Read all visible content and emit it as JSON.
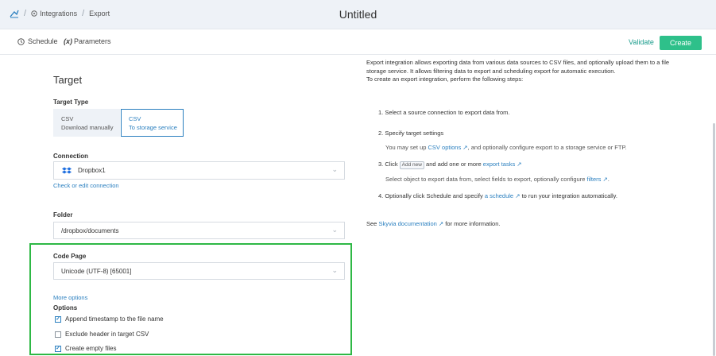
{
  "header": {
    "breadcrumb": [
      "Integrations",
      "Export"
    ],
    "title": "Untitled"
  },
  "subbar": {
    "tabs": [
      "Schedule",
      "Parameters"
    ],
    "parameters_prefix": "(x)",
    "validate_label": "Validate",
    "create_label": "Create"
  },
  "target": {
    "title": "Target",
    "type_label": "Target Type",
    "types": [
      {
        "name": "CSV",
        "desc": "Download manually",
        "selected": false
      },
      {
        "name": "CSV",
        "desc": "To storage service",
        "selected": true
      }
    ],
    "connection_label": "Connection",
    "connection_value": "Dropbox1",
    "check_link": "Check or edit connection",
    "folder_label": "Folder",
    "folder_value": "/dropbox/documents",
    "code_page_label": "Code Page",
    "code_page_value": "Unicode (UTF-8) [65001]",
    "more_options": "More options",
    "options_label": "Options",
    "options": [
      {
        "label": "Append timestamp to the file name",
        "checked": true
      },
      {
        "label": "Exclude header in target CSV",
        "checked": false
      },
      {
        "label": "Create empty files",
        "checked": true
      }
    ]
  },
  "help": {
    "intro": "Export integration allows exporting data from various data sources to CSV files, and optionally upload them to a file storage service. It allows filtering data to export and scheduling export for automatic execution.",
    "intro2": "To create an export integration, perform the following steps:",
    "step1": "1. Select a source connection to export data from.",
    "step2": "2. Specify target settings",
    "step2_sub_a": "You may set up ",
    "step2_sub_link": "CSV options",
    "step2_sub_b": ", and optionally configure export to a storage service or FTP.",
    "step3_a": "3. Click ",
    "step3_kbd": "Add new",
    "step3_b": " and add one or more ",
    "step3_link": "export tasks",
    "step3_sub_a": "Select object to export data from, select fields to export, optionally configure ",
    "step3_sub_link": "filters",
    "step3_sub_b": ".",
    "step4_a": "4. Optionally click Schedule and specify ",
    "step4_link": "a schedule",
    "step4_b": " to run your integration automatically.",
    "see_a": "See ",
    "see_link": "Skyvia documentation",
    "see_b": " for more information."
  },
  "colors": {
    "accent": "#2a7fbf",
    "create": "#2ec08a",
    "highlight": "#2eb845"
  }
}
